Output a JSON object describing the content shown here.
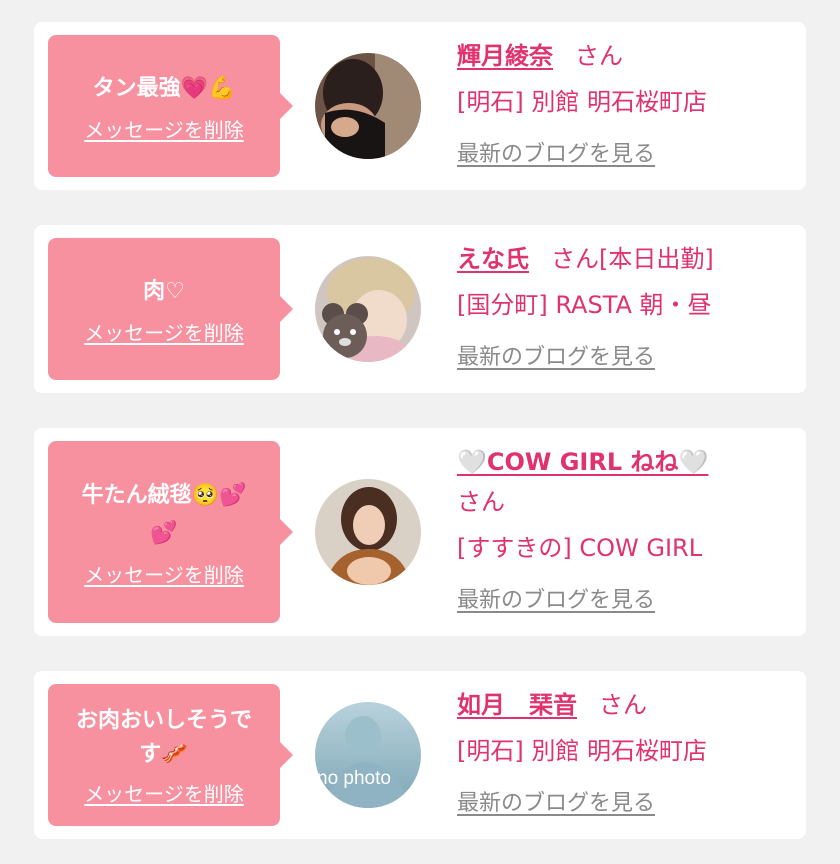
{
  "cards": [
    {
      "message": "タン最強💗💪",
      "delete_label": "メッセージを削除",
      "name": "輝月綾奈",
      "honorific": "さん",
      "status": "",
      "shop": "[明石] 別館 明石桜町店",
      "blog_label": "最新のブログを見る"
    },
    {
      "message": "肉♡",
      "delete_label": "メッセージを削除",
      "name": "えな氏",
      "honorific": "さん",
      "status": "[本日出勤]",
      "shop": "[国分町] RASTA 朝・昼",
      "blog_label": "最新のブログを見る"
    },
    {
      "message_line1": "牛たん絨毯🥺💕",
      "message_line2": "💕",
      "delete_label": "メッセージを削除",
      "name": "🤍COW GIRL ねね🤍",
      "honorific": "さん",
      "shop": "[すすきの] COW GIRL",
      "blog_label": "最新のブログを見る"
    },
    {
      "message_line1": "お肉おいしそうで",
      "message_line2": "す🥓",
      "delete_label": "メッセージを削除",
      "name": "如月　琹音",
      "honorific": "さん",
      "shop": "[明石] 別館 明石桜町店",
      "blog_label": "最新のブログを見る",
      "avatar_text": "no photo"
    }
  ],
  "colors": {
    "accent": "#e0336e",
    "bubble": "#f7909f",
    "muted": "#8a8a8a",
    "background": "#f1f1f1"
  }
}
